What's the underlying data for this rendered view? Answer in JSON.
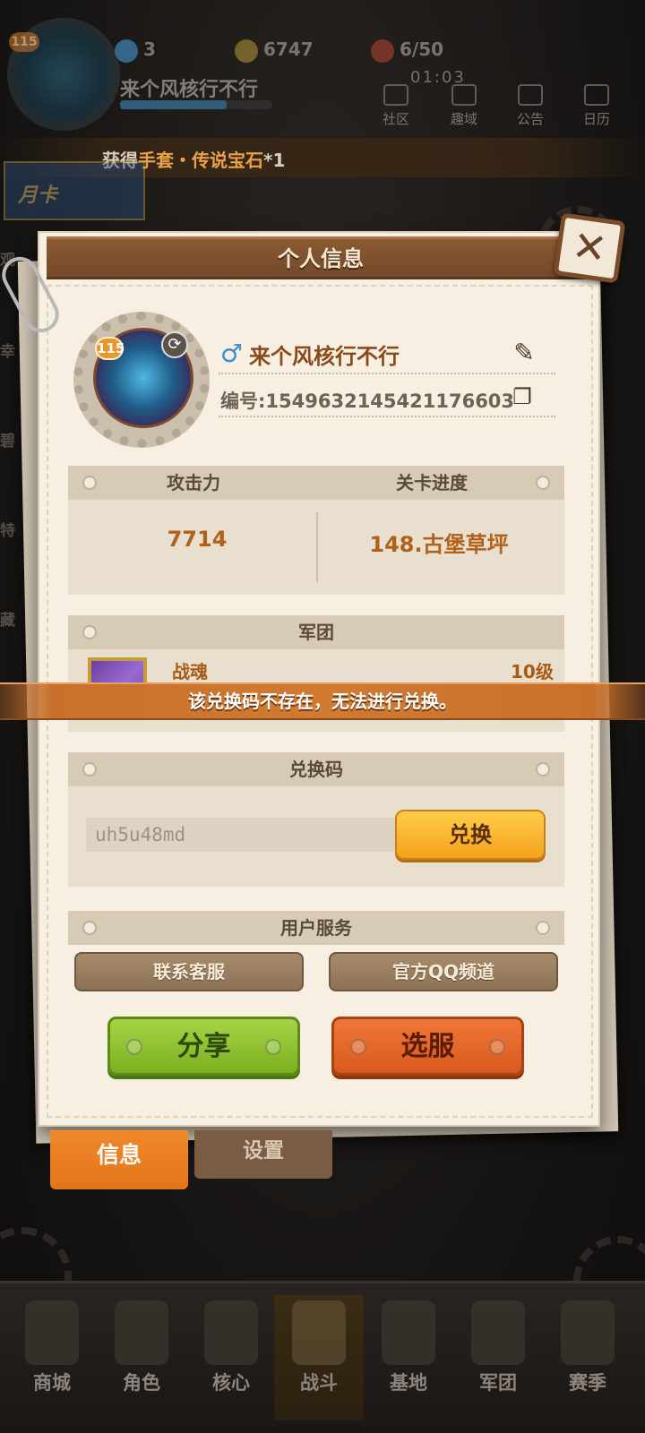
{
  "hud": {
    "avatar_level": "115",
    "gems": "3",
    "coins": "6747",
    "stamina": "6/50",
    "timer": "01:03",
    "player_name": "来个风核行不行",
    "top_buttons": [
      "社区",
      "趣域",
      "公告",
      "日历"
    ],
    "ticker_prefix": "获得",
    "ticker_item": "手套・传说宝石",
    "ticker_suffix": "*1",
    "month_card": "月卡",
    "side_labels": [
      "观",
      "幸",
      "碧",
      "特",
      "藏"
    ]
  },
  "panel": {
    "title": "个人信息",
    "close_symbol": "✕",
    "avatar_level": "115",
    "gender_symbol": "♂",
    "player_name": "来个风核行不行",
    "id_label": "编号:",
    "id_value": "1549632145421176603",
    "stats": {
      "attack_label": "攻击力",
      "attack_value": "7714",
      "progress_label": "关卡进度",
      "progress_value": "148.古堡草坪"
    },
    "legion": {
      "header": "军团",
      "name": "战魂",
      "level": "10级"
    },
    "redeem": {
      "header": "兑换码",
      "input_value": "uh5u48md",
      "button_label": "兑换"
    },
    "service": {
      "header": "用户服务",
      "contact_label": "联系客服",
      "qq_label": "官方QQ频道"
    },
    "share_label": "分享",
    "server_label": "选服"
  },
  "toast": "该兑换码不存在，无法进行兑换。",
  "panel_tabs": {
    "info": "信息",
    "settings": "设置"
  },
  "bottom_nav": [
    "商城",
    "角色",
    "核心",
    "战斗",
    "基地",
    "军团",
    "赛季"
  ],
  "colors": {
    "accent_orange": "#f08a2a",
    "title_brown": "#74492a",
    "share_green": "#7ab01e",
    "server_orange": "#d75a1c",
    "redeem_yellow": "#f4a21c"
  }
}
